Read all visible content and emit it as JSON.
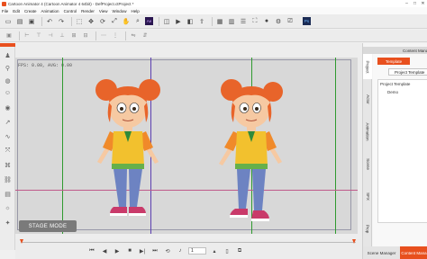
{
  "window": {
    "title": "Cartoon Animator 4 (Cartoon Animator 4 64bit) - DefProject.ctProject *",
    "controls": [
      "–",
      "□",
      "✕"
    ]
  },
  "menu": [
    "File",
    "Edit",
    "Create",
    "Animation",
    "Control",
    "Render",
    "View",
    "Window",
    "Help"
  ],
  "toolbar": {
    "ae_label": "Ae",
    "ps_label": "Ps"
  },
  "stage": {
    "fps_text": "FPS: 0.00, AVG: 0.00",
    "mode_label": "STAGE MODE"
  },
  "timeline": {
    "frame_value": "1"
  },
  "right_panel": {
    "header": "Content Mana",
    "vertical_tabs": [
      "Project",
      "Actor",
      "Animation",
      "Scene",
      "SFX",
      "Prop"
    ],
    "active_tab": "Template",
    "dropdown_value": "Project Template",
    "tree": [
      {
        "label": "Project Template",
        "level": 0
      },
      {
        "label": "Demo",
        "level": 1
      }
    ],
    "bottom_tabs": [
      "Scene Manager",
      "Content Mana"
    ]
  },
  "colors": {
    "accent": "#e8501e",
    "stage_bg": "#d8d8d8",
    "guide_green": "#2f9a2f",
    "guide_purple": "#5b3fb0",
    "guide_pink": "#c05a8a"
  }
}
